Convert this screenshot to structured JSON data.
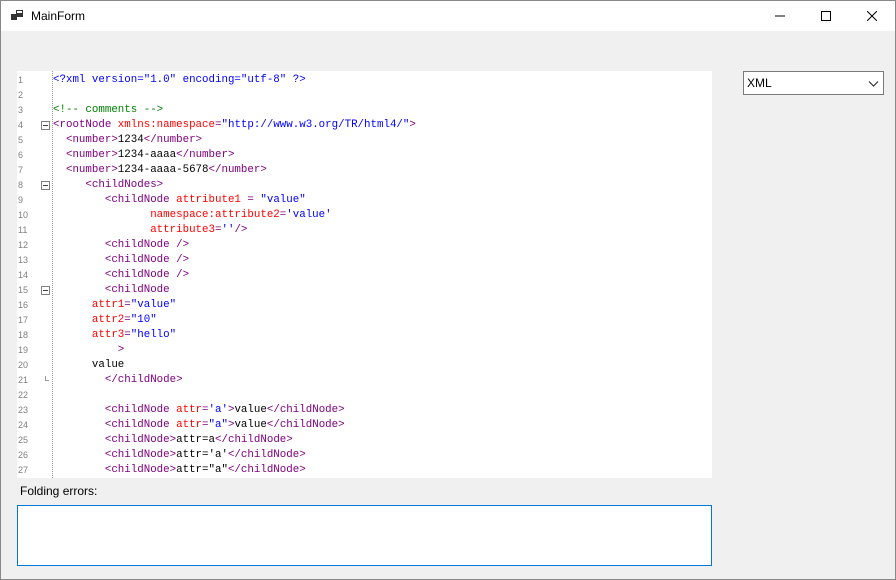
{
  "window": {
    "title": "MainForm",
    "icon": "app-window-icon",
    "controls": [
      "minimize-icon",
      "maximize-icon",
      "close-icon"
    ]
  },
  "editor": {
    "lines": [
      {
        "n": "1",
        "fold": "",
        "segs": [
          {
            "t": "<?xml version=\"1.0\" encoding=\"utf-8\" ?>",
            "c": "val"
          }
        ]
      },
      {
        "n": "2",
        "fold": "",
        "segs": []
      },
      {
        "n": "3",
        "fold": "",
        "segs": [
          {
            "t": "<!-- comments -->",
            "c": "comment"
          }
        ]
      },
      {
        "n": "4",
        "fold": "start",
        "segs": [
          {
            "t": "<rootNode ",
            "c": "tag"
          },
          {
            "t": "xmlns:namespace",
            "c": "attr"
          },
          {
            "t": "=",
            "c": "tag"
          },
          {
            "t": "\"http://www.w3.org/TR/html4/\"",
            "c": "val"
          },
          {
            "t": ">",
            "c": "tag"
          }
        ]
      },
      {
        "n": "5",
        "fold": "",
        "segs": [
          {
            "t": "  <number>",
            "c": "tag"
          },
          {
            "t": "1234",
            "c": "text"
          },
          {
            "t": "</number>",
            "c": "tag"
          }
        ]
      },
      {
        "n": "6",
        "fold": "",
        "segs": [
          {
            "t": "  <number>",
            "c": "tag"
          },
          {
            "t": "1234-aaaa",
            "c": "text"
          },
          {
            "t": "</number>",
            "c": "tag"
          }
        ]
      },
      {
        "n": "7",
        "fold": "",
        "segs": [
          {
            "t": "  <number>",
            "c": "tag"
          },
          {
            "t": "1234-aaaa-5678",
            "c": "text"
          },
          {
            "t": "</number>",
            "c": "tag"
          }
        ]
      },
      {
        "n": "8",
        "fold": "start",
        "segs": [
          {
            "t": "     <childNodes>",
            "c": "tag"
          }
        ]
      },
      {
        "n": "9",
        "fold": "",
        "segs": [
          {
            "t": "        <childNode ",
            "c": "tag"
          },
          {
            "t": "attribute1",
            "c": "attr"
          },
          {
            "t": " = ",
            "c": "tag"
          },
          {
            "t": "\"value\"",
            "c": "val"
          }
        ]
      },
      {
        "n": "10",
        "fold": "",
        "segs": [
          {
            "t": "               namespace:attribute2",
            "c": "attr"
          },
          {
            "t": "=",
            "c": "tag"
          },
          {
            "t": "'value'",
            "c": "val"
          }
        ]
      },
      {
        "n": "11",
        "fold": "",
        "segs": [
          {
            "t": "               attribute3",
            "c": "attr"
          },
          {
            "t": "=",
            "c": "tag"
          },
          {
            "t": "''",
            "c": "val"
          },
          {
            "t": "/>",
            "c": "tag"
          }
        ]
      },
      {
        "n": "12",
        "fold": "",
        "segs": [
          {
            "t": "        <childNode />",
            "c": "tag"
          }
        ]
      },
      {
        "n": "13",
        "fold": "",
        "segs": [
          {
            "t": "        <childNode />",
            "c": "tag"
          }
        ]
      },
      {
        "n": "14",
        "fold": "",
        "segs": [
          {
            "t": "        <childNode />",
            "c": "tag"
          }
        ]
      },
      {
        "n": "15",
        "fold": "start",
        "segs": [
          {
            "t": "        <childNode",
            "c": "tag"
          }
        ]
      },
      {
        "n": "16",
        "fold": "",
        "segs": [
          {
            "t": "      attr1",
            "c": "attr"
          },
          {
            "t": "=",
            "c": "tag"
          },
          {
            "t": "\"value\"",
            "c": "val"
          }
        ]
      },
      {
        "n": "17",
        "fold": "",
        "segs": [
          {
            "t": "      attr2",
            "c": "attr"
          },
          {
            "t": "=",
            "c": "tag"
          },
          {
            "t": "\"10\"",
            "c": "val"
          }
        ]
      },
      {
        "n": "18",
        "fold": "",
        "segs": [
          {
            "t": "      attr3",
            "c": "attr"
          },
          {
            "t": "=",
            "c": "tag"
          },
          {
            "t": "\"hello\"",
            "c": "val"
          }
        ]
      },
      {
        "n": "19",
        "fold": "",
        "segs": [
          {
            "t": "          >",
            "c": "tag"
          }
        ]
      },
      {
        "n": "20",
        "fold": "",
        "segs": [
          {
            "t": "      value",
            "c": "text"
          }
        ]
      },
      {
        "n": "21",
        "fold": "end",
        "segs": [
          {
            "t": "        </childNode>",
            "c": "tag"
          }
        ]
      },
      {
        "n": "22",
        "fold": "",
        "segs": []
      },
      {
        "n": "23",
        "fold": "",
        "segs": [
          {
            "t": "        <childNode ",
            "c": "tag"
          },
          {
            "t": "attr",
            "c": "attr"
          },
          {
            "t": "=",
            "c": "tag"
          },
          {
            "t": "'a'",
            "c": "val"
          },
          {
            "t": ">",
            "c": "tag"
          },
          {
            "t": "value",
            "c": "text"
          },
          {
            "t": "</childNode>",
            "c": "tag"
          }
        ]
      },
      {
        "n": "24",
        "fold": "",
        "segs": [
          {
            "t": "        <childNode ",
            "c": "tag"
          },
          {
            "t": "attr",
            "c": "attr"
          },
          {
            "t": "=",
            "c": "tag"
          },
          {
            "t": "\"a\"",
            "c": "val"
          },
          {
            "t": ">",
            "c": "tag"
          },
          {
            "t": "value",
            "c": "text"
          },
          {
            "t": "</childNode>",
            "c": "tag"
          }
        ]
      },
      {
        "n": "25",
        "fold": "",
        "segs": [
          {
            "t": "        <childNode>",
            "c": "tag"
          },
          {
            "t": "attr=a",
            "c": "text"
          },
          {
            "t": "</childNode>",
            "c": "tag"
          }
        ]
      },
      {
        "n": "26",
        "fold": "",
        "segs": [
          {
            "t": "        <childNode>",
            "c": "tag"
          },
          {
            "t": "attr='a'",
            "c": "text"
          },
          {
            "t": "</childNode>",
            "c": "tag"
          }
        ]
      },
      {
        "n": "27",
        "fold": "",
        "segs": [
          {
            "t": "        <childNode>",
            "c": "tag"
          },
          {
            "t": "attr=\"a\"",
            "c": "text"
          },
          {
            "t": "</childNode>",
            "c": "tag"
          }
        ]
      }
    ]
  },
  "language_select": {
    "value": "XML",
    "icon": "chevron-down-icon"
  },
  "folding_errors": {
    "label": "Folding errors:",
    "value": ""
  },
  "colors": {
    "tag": "#800080",
    "attribute": "#ff0000",
    "value": "#0000ff",
    "comment": "#008000",
    "focus_border": "#0078d7"
  }
}
